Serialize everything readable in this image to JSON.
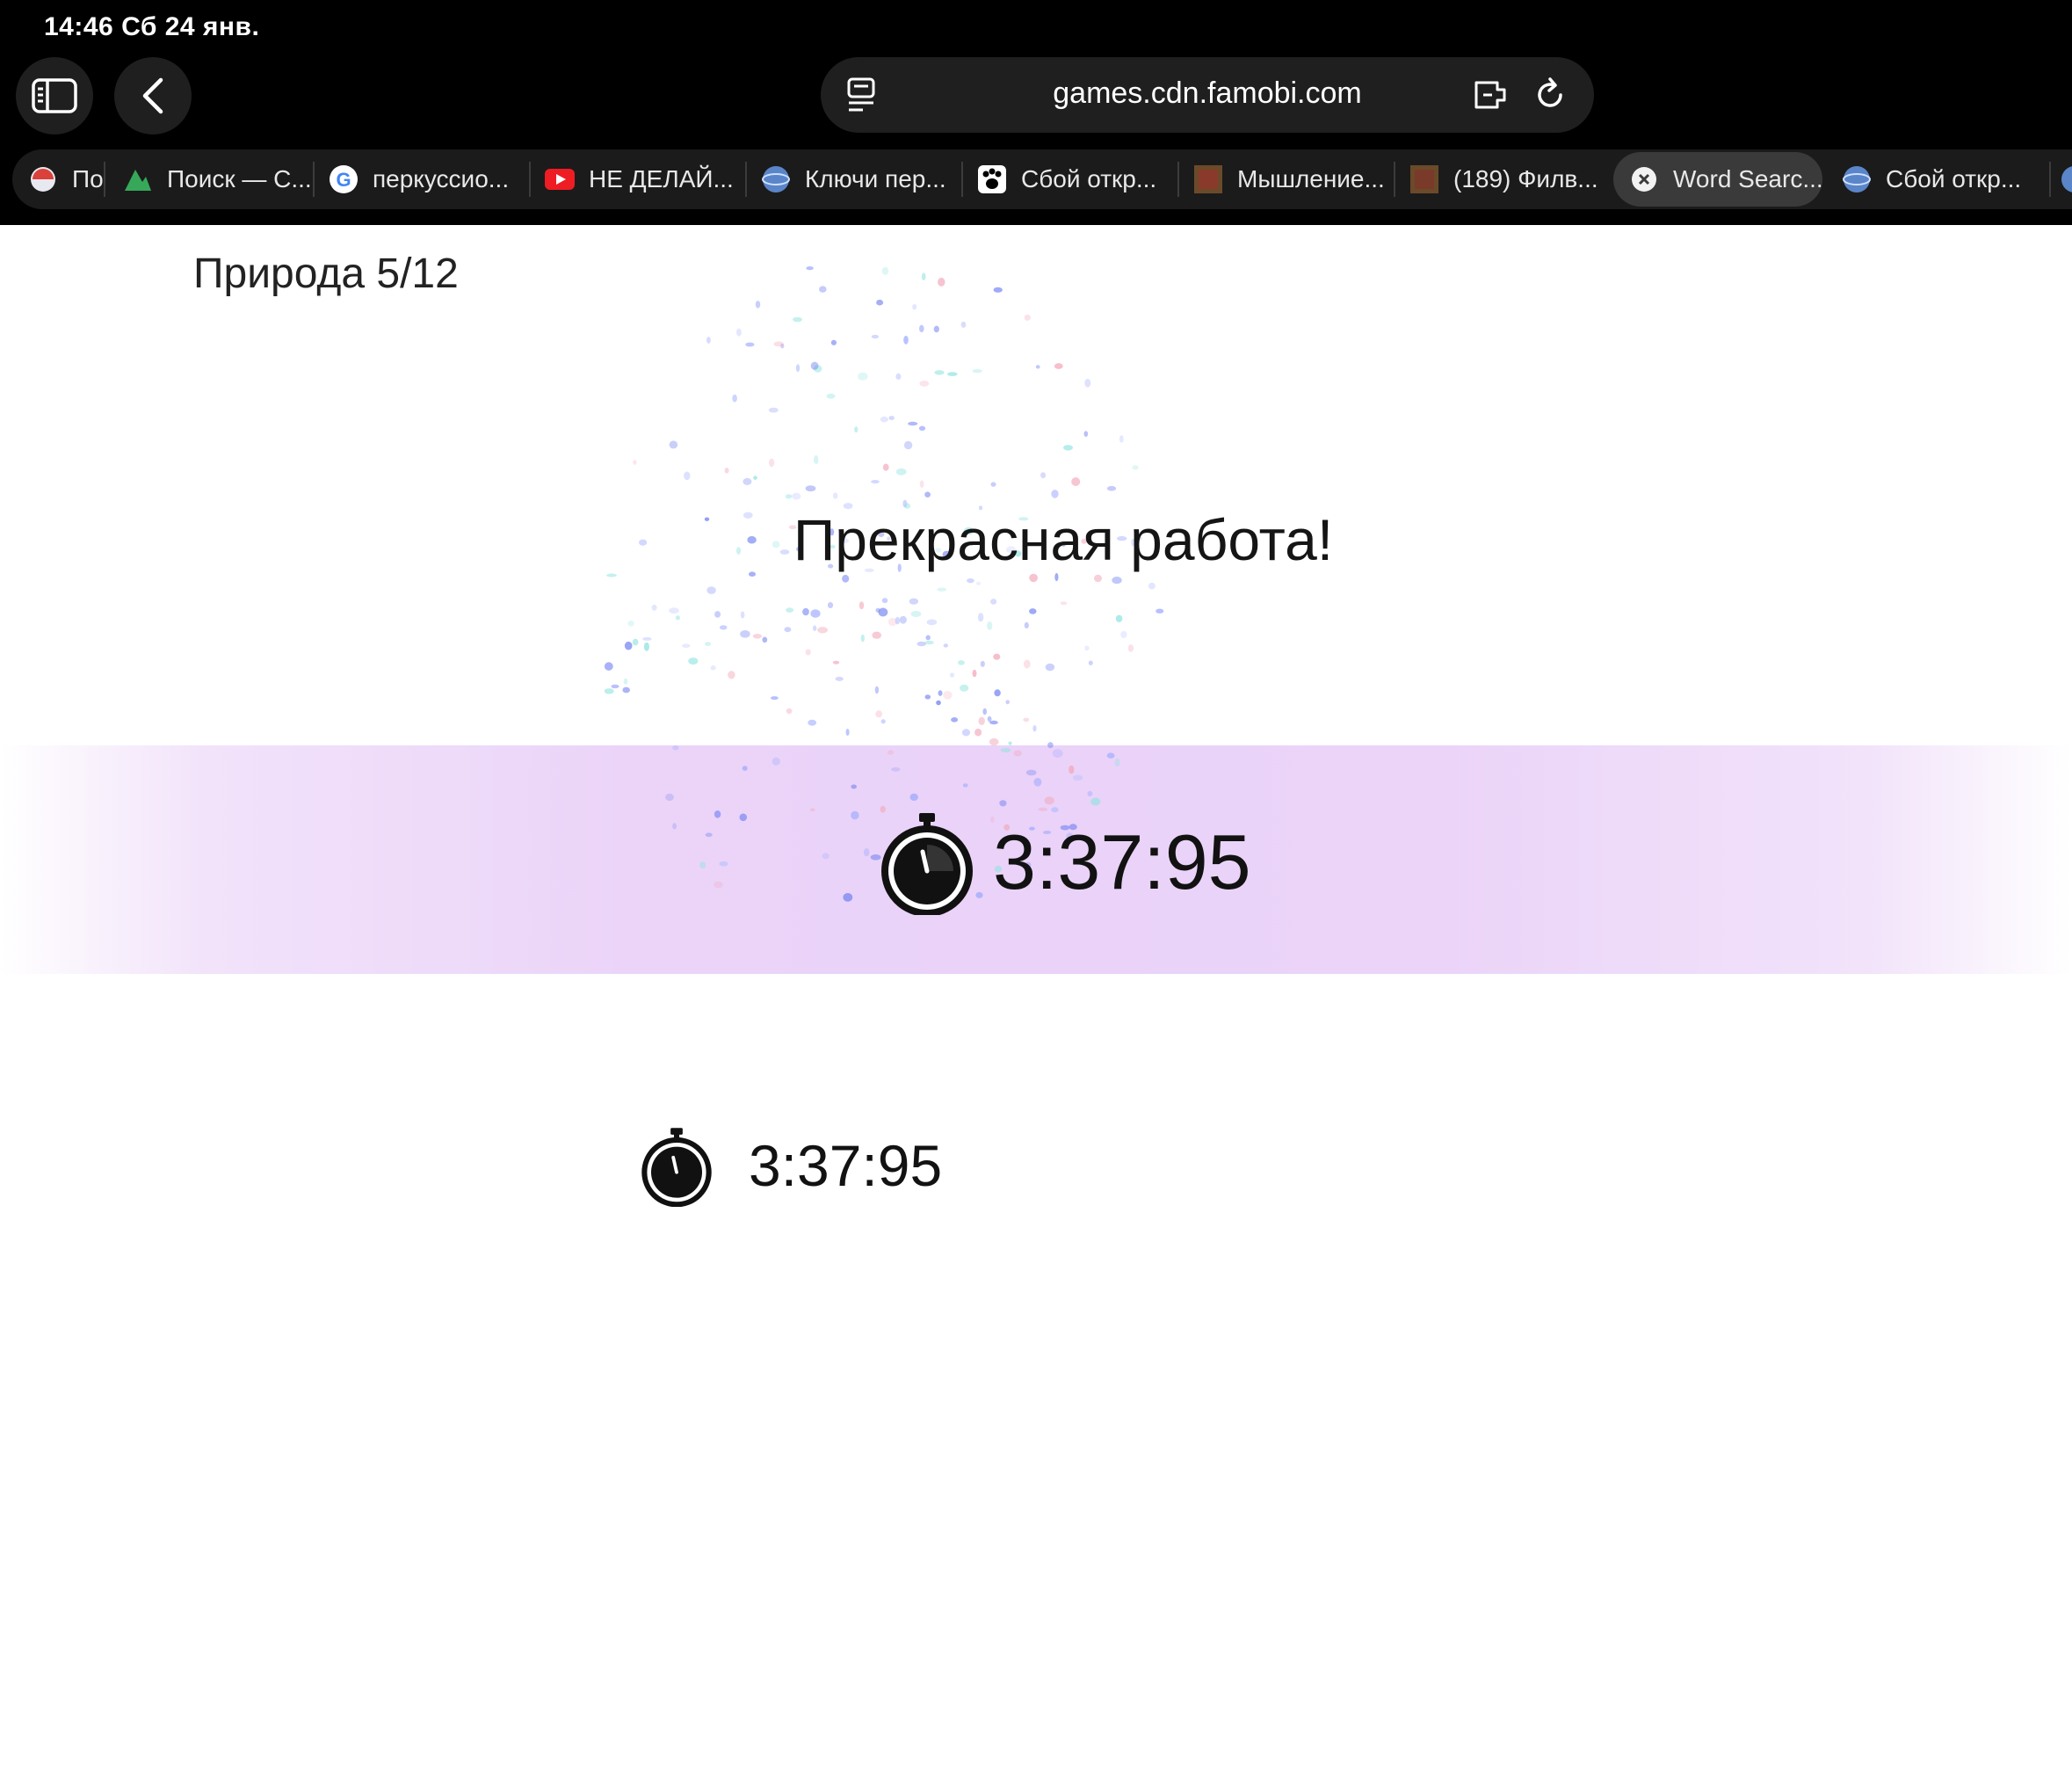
{
  "status_bar": {
    "time_date": "14:46   Сб 24 янв."
  },
  "browser": {
    "url": "games.cdn.famobi.com",
    "tabs": [
      {
        "label": "По",
        "icon": "umbrella-favicon"
      },
      {
        "label": "Поиск — С...",
        "icon": "mountain-favicon"
      },
      {
        "label": "перкуссио...",
        "icon": "google-favicon"
      },
      {
        "label": "НЕ ДЕЛАЙ...",
        "icon": "youtube-favicon"
      },
      {
        "label": "Ключи пер...",
        "icon": "globe-favicon"
      },
      {
        "label": "Сбой откр...",
        "icon": "paw-favicon"
      },
      {
        "label": "Мышление...",
        "icon": "thumbnail-favicon"
      },
      {
        "label": "(189) Филв...",
        "icon": "thumbnail-favicon"
      },
      {
        "label": "Word Searc...",
        "icon": "close-icon",
        "active": true
      },
      {
        "label": "Сбой откр...",
        "icon": "globe-favicon"
      }
    ]
  },
  "game": {
    "level": "Природа 5/12",
    "message": "Прекрасная работа!",
    "time_highlight": "3:37:95",
    "time_best": "3:37:95"
  },
  "colors": {
    "browser_chrome": "#000000",
    "band": "#ead2f8",
    "text": "#151515"
  }
}
